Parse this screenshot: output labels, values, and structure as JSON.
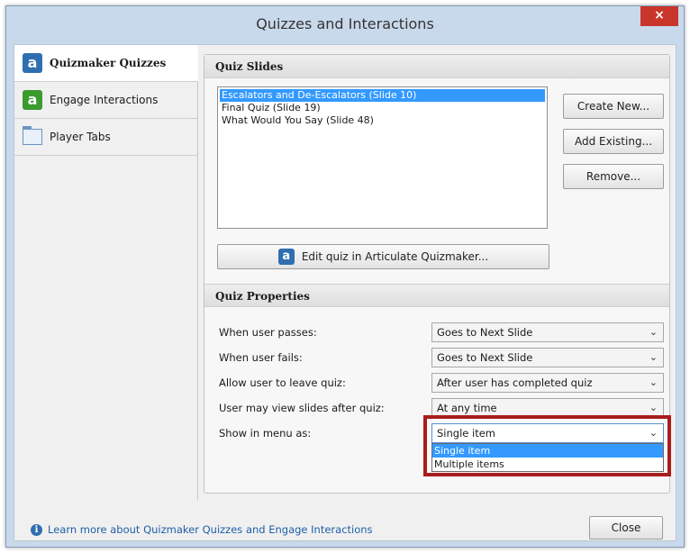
{
  "window": {
    "title": "Quizzes and Interactions",
    "close_glyph": "×"
  },
  "sidebar": {
    "items": [
      {
        "label": "Quizmaker Quizzes",
        "icon": "quizmaker-icon",
        "glyph": "a",
        "active": true
      },
      {
        "label": "Engage Interactions",
        "icon": "engage-icon",
        "glyph": "a",
        "active": false
      },
      {
        "label": "Player Tabs",
        "icon": "player-tabs-icon",
        "active": false
      }
    ]
  },
  "quiz_slides": {
    "header": "Quiz Slides",
    "items": [
      "Escalators and De-Escalators (Slide 10)",
      "Final Quiz (Slide 19)",
      "What Would You Say (Slide 48)"
    ],
    "selected_index": 0,
    "buttons": {
      "create": "Create New...",
      "add": "Add Existing...",
      "remove": "Remove..."
    },
    "edit_button": "Edit quiz in Articulate Quizmaker...",
    "edit_button_glyph": "a"
  },
  "quiz_properties": {
    "header": "Quiz Properties",
    "rows": [
      {
        "label": "When user passes:",
        "value": "Goes to Next Slide"
      },
      {
        "label": "When user fails:",
        "value": "Goes to Next Slide"
      },
      {
        "label": "Allow user to leave quiz:",
        "value": "After user has completed quiz"
      },
      {
        "label": "User may view slides after quiz:",
        "value": "At any time"
      },
      {
        "label": "Show in menu as:",
        "value": "Single item"
      }
    ],
    "dropdown_options": [
      "Single item",
      "Multiple items"
    ],
    "chevron": "⌄"
  },
  "footer": {
    "link_text": "Learn more about Quizmaker Quizzes and Engage Interactions",
    "info_glyph": "i",
    "close_button": "Close"
  },
  "colors": {
    "selection": "#3399ff",
    "highlight_box": "#a81d1d",
    "title_close": "#c8352b"
  }
}
